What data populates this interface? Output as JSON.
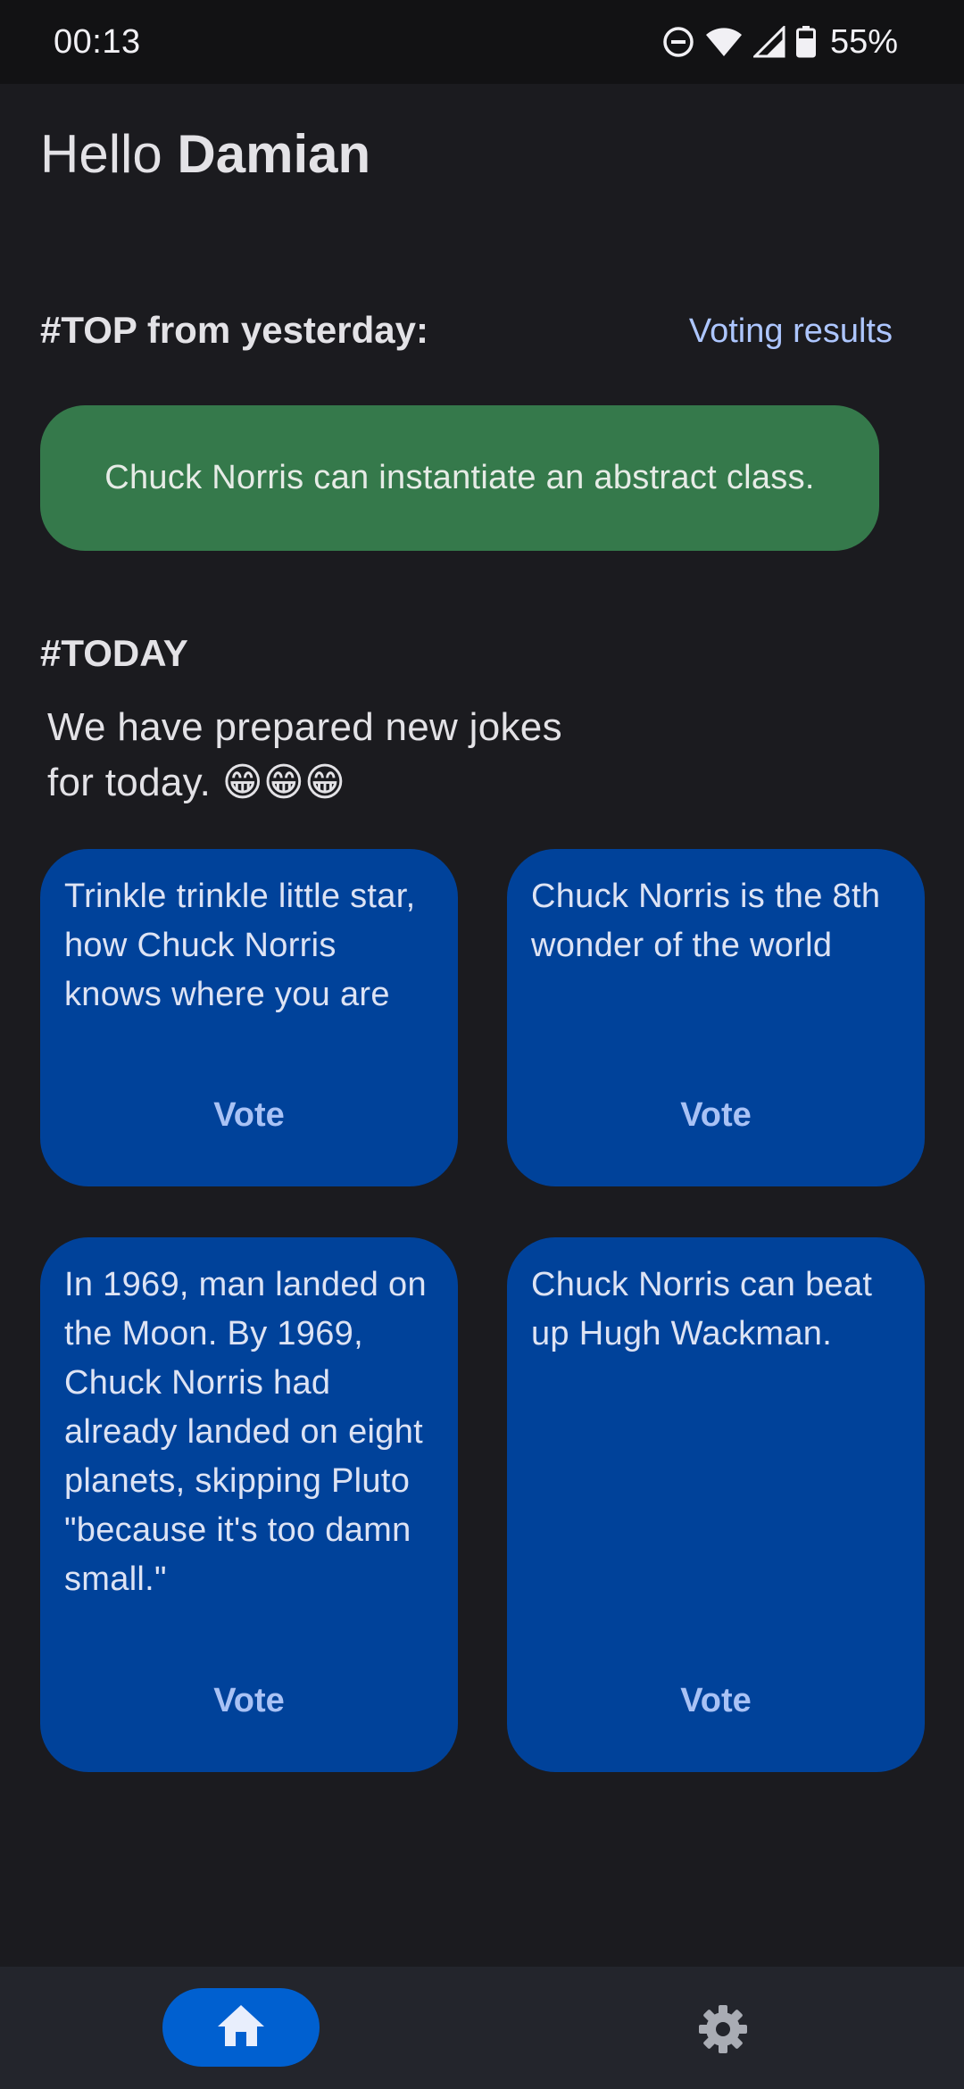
{
  "status_bar": {
    "time": "00:13",
    "battery_percent": "55%",
    "icons": [
      "do-not-disturb-icon",
      "wifi-icon",
      "cell-signal-icon",
      "battery-icon"
    ]
  },
  "greeting": {
    "hello": "Hello",
    "name": "Damian"
  },
  "top_section": {
    "heading": "#TOP from yesterday:",
    "voting_results_link": "Voting results",
    "top_joke": "Chuck Norris can instantiate an abstract class.",
    "card_color": "#35794b"
  },
  "today_section": {
    "heading": "#TODAY",
    "subtitle": "We have prepared new jokes for today. 😁😁😁"
  },
  "jokes": [
    {
      "text": "Trinkle trinkle little star, how Chuck Norris knows where you are",
      "vote_label": "Vote"
    },
    {
      "text": "Chuck Norris is the 8th wonder of the world",
      "vote_label": "Vote"
    },
    {
      "text": "In 1969, man landed on the Moon. By 1969, Chuck Norris had already landed on eight planets, skipping Pluto \"because it's too damn small.\"",
      "vote_label": "Vote"
    },
    {
      "text": "Chuck Norris can beat up Hugh Wackman.",
      "vote_label": "Vote"
    }
  ],
  "joke_card_color": "#00429a",
  "bottom_nav": {
    "items": [
      {
        "icon": "home-icon",
        "selected": true
      },
      {
        "icon": "gear-icon",
        "selected": false
      }
    ],
    "accent": "#0060d0"
  }
}
